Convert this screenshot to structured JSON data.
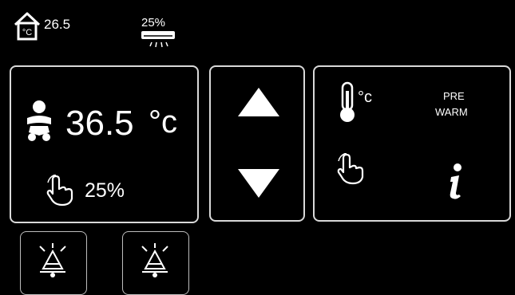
{
  "status": {
    "room_temp": "26.5",
    "heater_power": "25%",
    "icons": [
      "home-temp-icon",
      "radiant-heater-icon"
    ]
  },
  "main_panel": {
    "baby_temp_value": "36.5",
    "baby_temp_unit": "°c",
    "power_value": "25%",
    "icons": [
      "baby-icon",
      "hand-touch-icon"
    ]
  },
  "arrows": {
    "icons": [
      "arrow-up-icon",
      "arrow-down-icon"
    ]
  },
  "right_panel": {
    "thermometer_unit": "°c",
    "prewarm_line1": "PRE",
    "prewarm_line2": "WARM",
    "icons": [
      "thermometer-icon",
      "hand-touch-icon",
      "info-icon"
    ]
  },
  "bottom": {
    "icons": [
      "alarm-bell-icon",
      "alarm-bell-icon"
    ]
  },
  "colors": {
    "background": "#000000",
    "foreground": "#ffffff",
    "panel_border": "#d9d9d9"
  }
}
